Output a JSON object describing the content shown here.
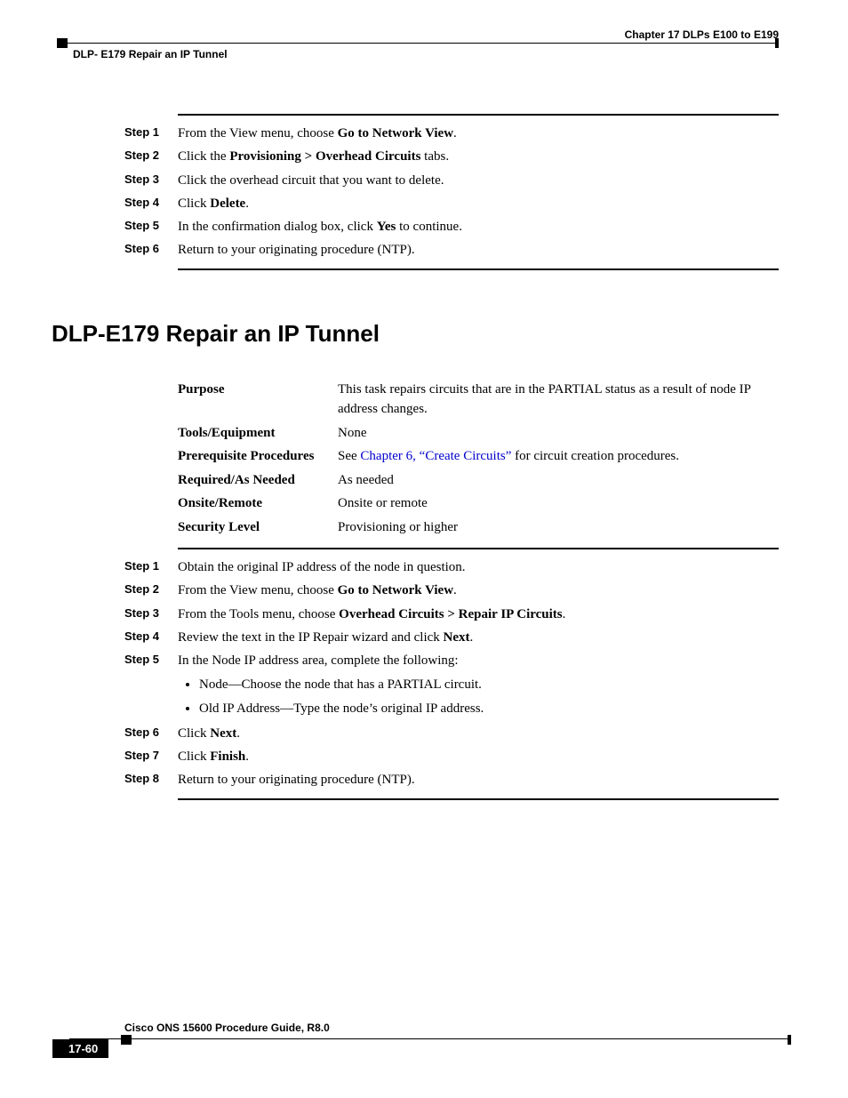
{
  "header": {
    "chapter": "Chapter 17      DLPs E100 to E199",
    "subtitle": "DLP- E179 Repair an IP Tunnel"
  },
  "steps_a": [
    {
      "label": "Step 1",
      "html": "From the View menu, choose <b>Go to Network View</b>."
    },
    {
      "label": "Step 2",
      "html": "Click the <b>Provisioning &gt; Overhead Circuits</b> tabs."
    },
    {
      "label": "Step 3",
      "html": "Click the overhead circuit that you want to delete."
    },
    {
      "label": "Step 4",
      "html": "Click <b>Delete</b>."
    },
    {
      "label": "Step 5",
      "html": "In the confirmation dialog box, click <b>Yes</b> to continue."
    },
    {
      "label": "Step 6",
      "html": "Return to your originating procedure (NTP)."
    }
  ],
  "section_title": "DLP-E179 Repair an IP Tunnel",
  "info": {
    "purpose_label": "Purpose",
    "purpose_value": "This task repairs circuits that are in the PARTIAL status as a result of node IP address changes.",
    "tools_label": "Tools/Equipment",
    "tools_value": "None",
    "prereq_label": "Prerequisite Procedures",
    "prereq_prefix": "See ",
    "prereq_link": "Chapter 6, “Create Circuits”",
    "prereq_suffix": " for circuit creation procedures.",
    "required_label": "Required/As Needed",
    "required_value": "As needed",
    "onsite_label": "Onsite/Remote",
    "onsite_value": "Onsite or remote",
    "security_label": "Security Level",
    "security_value": "Provisioning or higher"
  },
  "steps_b": [
    {
      "label": "Step 1",
      "html": "Obtain the original IP address of the node in question."
    },
    {
      "label": "Step 2",
      "html": "From the View menu, choose <b>Go to Network View</b>."
    },
    {
      "label": "Step 3",
      "html": "From the Tools menu, choose <b>Overhead Circuits &gt; Repair IP Circuits</b>."
    },
    {
      "label": "Step 4",
      "html": "Review the text in the IP Repair wizard and click <b>Next</b>."
    },
    {
      "label": "Step 5",
      "html": "In the Node IP address area, complete the following:"
    }
  ],
  "bullets": [
    "Node—Choose the node that has a PARTIAL circuit.",
    "Old IP Address—Type the node’s original IP address."
  ],
  "steps_c": [
    {
      "label": "Step 6",
      "html": "Click <b>Next</b>."
    },
    {
      "label": "Step 7",
      "html": "Click <b>Finish</b>."
    },
    {
      "label": "Step 8",
      "html": "Return to your originating procedure (NTP)."
    }
  ],
  "footer": {
    "title": "Cisco ONS 15600 Procedure Guide, R8.0",
    "page": "17-60"
  }
}
